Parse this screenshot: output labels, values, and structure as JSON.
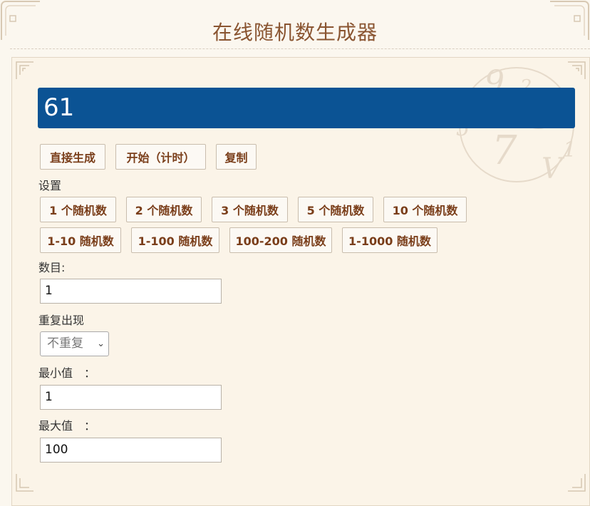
{
  "header": {
    "title": "在线随机数生成器"
  },
  "result": {
    "value": "61"
  },
  "actions": {
    "generate": "直接生成",
    "start_timer": "开始（计时）",
    "copy": "复制"
  },
  "settings": {
    "label": "设置",
    "count_presets": [
      "1 个随机数",
      "2 个随机数",
      "3 个随机数",
      "5 个随机数",
      "10 个随机数"
    ],
    "range_presets": [
      "1-10 随机数",
      "1-100 随机数",
      "100-200 随机数",
      "1-1000 随机数"
    ]
  },
  "form": {
    "count_label": "数目:",
    "count_value": "1",
    "repeat_label": "重复出现",
    "repeat_selected": "不重复",
    "min_label": "最小值　：",
    "min_value": "1",
    "max_label": "最大值　：",
    "max_value": "100"
  },
  "colors": {
    "result_bg": "#0b5394",
    "button_text": "#7a3e1a",
    "title": "#8a5531",
    "page_bg": "#fbf7ef"
  }
}
